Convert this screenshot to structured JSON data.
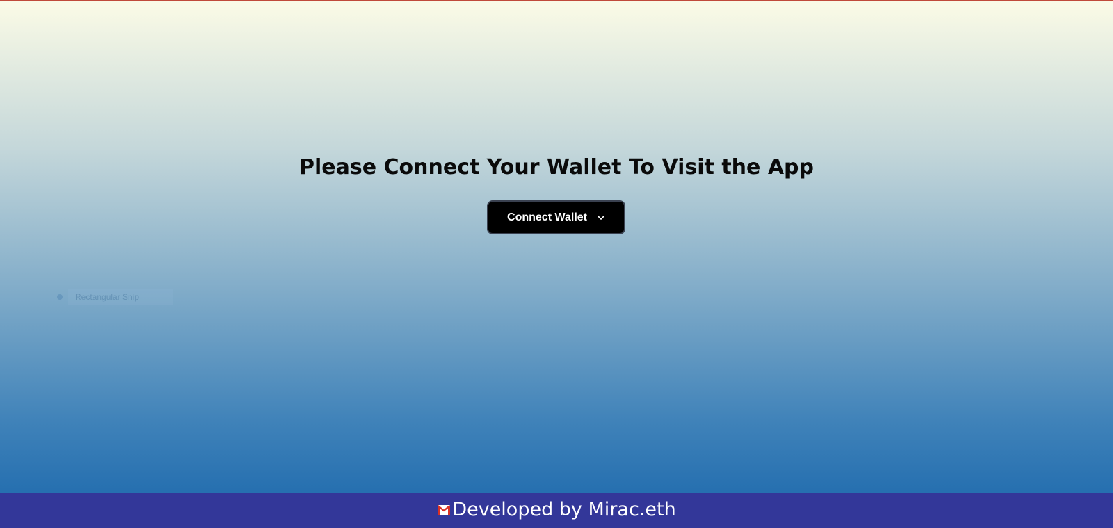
{
  "main": {
    "heading": "Please Connect Your Wallet To Visit the App",
    "connect_button_label": "Connect Wallet",
    "connect_button_icon": "chevron-down-icon"
  },
  "overlay": {
    "snip_label": "Rectangular Snip"
  },
  "footer": {
    "icon": "mail-icon",
    "text": "Developed by Mirac.eth"
  },
  "colors": {
    "gradient_top": "#fbfbe6",
    "gradient_bottom": "#1966ab",
    "button_bg": "#000000",
    "footer_bg": "#333799"
  }
}
